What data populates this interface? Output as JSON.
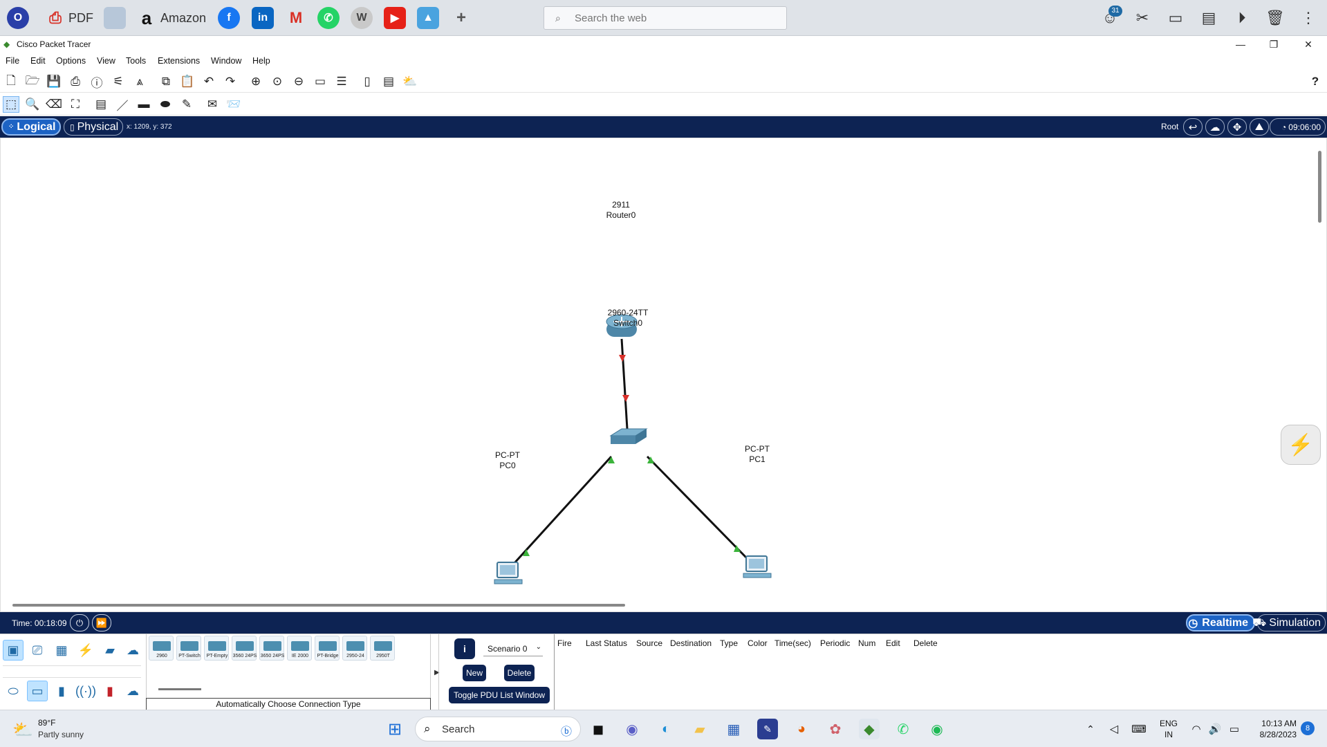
{
  "browser": {
    "pdf_label": "PDF",
    "amazon_label": "Amazon",
    "search_placeholder": "Search the web",
    "badge_count": "31"
  },
  "app": {
    "title": "Cisco Packet Tracer"
  },
  "menu": [
    "File",
    "Edit",
    "Options",
    "View",
    "Tools",
    "Extensions",
    "Window",
    "Help"
  ],
  "navbar": {
    "logical": "Logical",
    "physical": "Physical",
    "coords": "x: 1209, y: 372",
    "root": "Root",
    "clock": "09:06:00"
  },
  "devices": {
    "router": {
      "model": "2911",
      "name": "Router0"
    },
    "switch": {
      "model": "2960-24TT",
      "name": "Switch0"
    },
    "pc0": {
      "model": "PC-PT",
      "name": "PC0"
    },
    "pc1": {
      "model": "PC-PT",
      "name": "PC1"
    }
  },
  "link_colors": {
    "down": "#d9312b",
    "up": "#3cb43c"
  },
  "timebar": {
    "time": "Time: 00:18:09",
    "realtime": "Realtime",
    "simulation": "Simulation"
  },
  "device_list": [
    "2960",
    "PT-Switch",
    "PT-Empty",
    "3560 24PS",
    "3650 24PS",
    "IE 2000",
    "PT-Bridge",
    "2950-24",
    "2950T"
  ],
  "connection_label": "Automatically Choose Connection Type",
  "scenario": {
    "selected": "Scenario 0",
    "new_label": "New",
    "delete_label": "Delete",
    "toggle_label": "Toggle PDU List Window"
  },
  "pdu_columns": [
    "Fire",
    "Last Status",
    "Source",
    "Destination",
    "Type",
    "Color",
    "Time(sec)",
    "Periodic",
    "Num",
    "Edit",
    "Delete"
  ],
  "taskbar": {
    "temp": "89°F",
    "weather": "Partly sunny",
    "search": "Search",
    "lang_top": "ENG",
    "lang_bottom": "IN",
    "time": "10:13 AM",
    "date": "8/28/2023",
    "notif": "8"
  }
}
